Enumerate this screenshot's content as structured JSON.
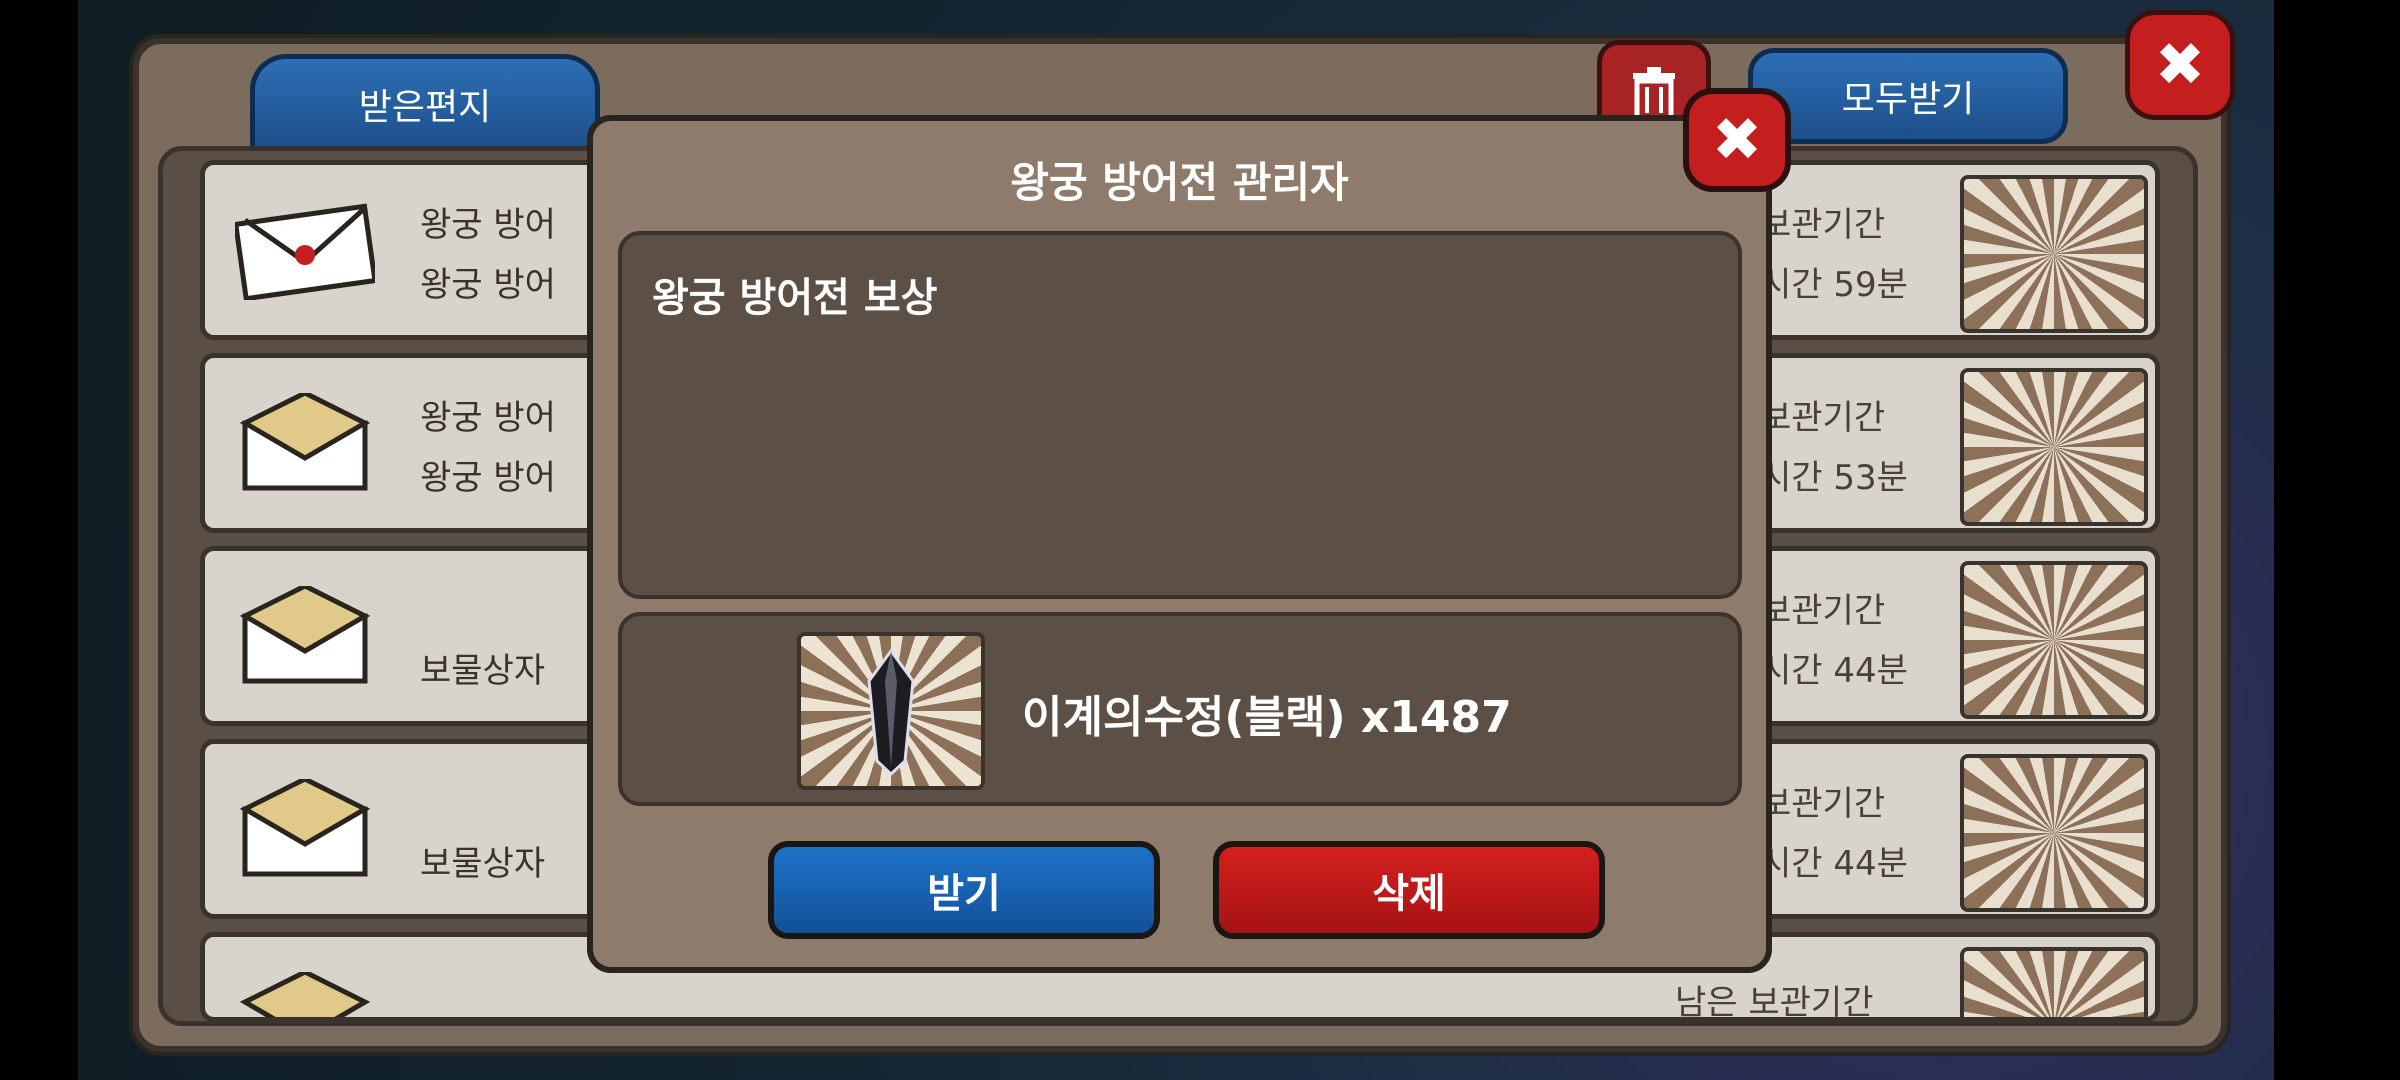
{
  "mailbox": {
    "tab_received": "받은편지",
    "claim_all": "모두받기",
    "rows": [
      {
        "t1": "왕궁 방어",
        "t2": "왕궁 방어",
        "r1": "보관기간",
        "r2": "시간 59분"
      },
      {
        "t1": "왕궁 방어",
        "t2": "왕궁 방어",
        "r1": "보관기간",
        "r2": "시간 53분"
      },
      {
        "t1": "",
        "t2": "보물상자",
        "r1": "보관기간",
        "r2": "시간 44분"
      },
      {
        "t1": "",
        "t2": "보물상자",
        "r1": "보관기간",
        "r2": "시간 44분"
      },
      {
        "t1": "",
        "t2": "",
        "r1": "남은 보관기간",
        "r2": ""
      }
    ]
  },
  "modal": {
    "title": "왕궁 방어전 관리자",
    "message": "왕궁 방어전 보상",
    "reward": "이계의수정(블랙) x1487",
    "claim_button": "받기",
    "delete_button": "삭제"
  },
  "icons": {
    "close": "close-icon",
    "trash": "trash-icon",
    "envelope": "envelope-icon",
    "crystal": "black-crystal-icon"
  }
}
